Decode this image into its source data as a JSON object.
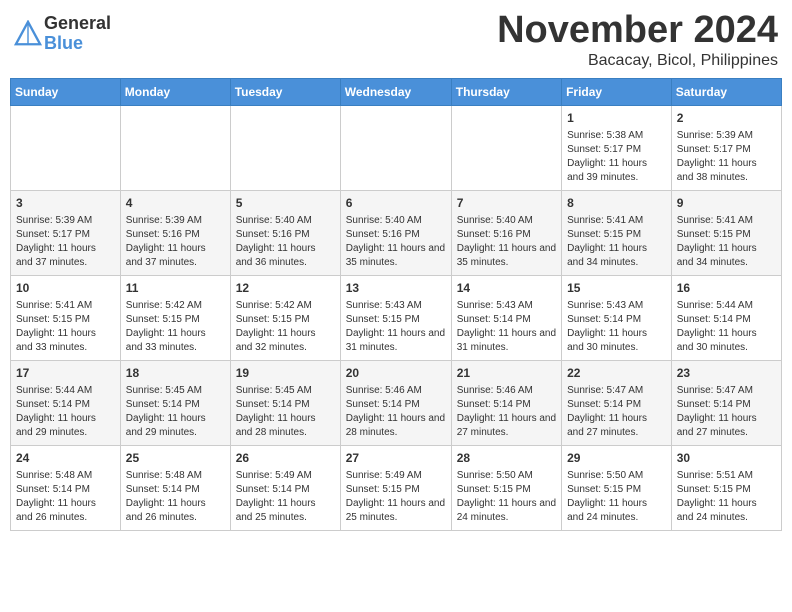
{
  "header": {
    "logo_general": "General",
    "logo_blue": "Blue",
    "month_title": "November 2024",
    "location": "Bacacay, Bicol, Philippines"
  },
  "weekdays": [
    "Sunday",
    "Monday",
    "Tuesday",
    "Wednesday",
    "Thursday",
    "Friday",
    "Saturday"
  ],
  "weeks": [
    [
      {
        "day": "",
        "sunrise": "",
        "sunset": "",
        "daylight": ""
      },
      {
        "day": "",
        "sunrise": "",
        "sunset": "",
        "daylight": ""
      },
      {
        "day": "",
        "sunrise": "",
        "sunset": "",
        "daylight": ""
      },
      {
        "day": "",
        "sunrise": "",
        "sunset": "",
        "daylight": ""
      },
      {
        "day": "",
        "sunrise": "",
        "sunset": "",
        "daylight": ""
      },
      {
        "day": "1",
        "sunrise": "Sunrise: 5:38 AM",
        "sunset": "Sunset: 5:17 PM",
        "daylight": "Daylight: 11 hours and 39 minutes."
      },
      {
        "day": "2",
        "sunrise": "Sunrise: 5:39 AM",
        "sunset": "Sunset: 5:17 PM",
        "daylight": "Daylight: 11 hours and 38 minutes."
      }
    ],
    [
      {
        "day": "3",
        "sunrise": "Sunrise: 5:39 AM",
        "sunset": "Sunset: 5:17 PM",
        "daylight": "Daylight: 11 hours and 37 minutes."
      },
      {
        "day": "4",
        "sunrise": "Sunrise: 5:39 AM",
        "sunset": "Sunset: 5:16 PM",
        "daylight": "Daylight: 11 hours and 37 minutes."
      },
      {
        "day": "5",
        "sunrise": "Sunrise: 5:40 AM",
        "sunset": "Sunset: 5:16 PM",
        "daylight": "Daylight: 11 hours and 36 minutes."
      },
      {
        "day": "6",
        "sunrise": "Sunrise: 5:40 AM",
        "sunset": "Sunset: 5:16 PM",
        "daylight": "Daylight: 11 hours and 35 minutes."
      },
      {
        "day": "7",
        "sunrise": "Sunrise: 5:40 AM",
        "sunset": "Sunset: 5:16 PM",
        "daylight": "Daylight: 11 hours and 35 minutes."
      },
      {
        "day": "8",
        "sunrise": "Sunrise: 5:41 AM",
        "sunset": "Sunset: 5:15 PM",
        "daylight": "Daylight: 11 hours and 34 minutes."
      },
      {
        "day": "9",
        "sunrise": "Sunrise: 5:41 AM",
        "sunset": "Sunset: 5:15 PM",
        "daylight": "Daylight: 11 hours and 34 minutes."
      }
    ],
    [
      {
        "day": "10",
        "sunrise": "Sunrise: 5:41 AM",
        "sunset": "Sunset: 5:15 PM",
        "daylight": "Daylight: 11 hours and 33 minutes."
      },
      {
        "day": "11",
        "sunrise": "Sunrise: 5:42 AM",
        "sunset": "Sunset: 5:15 PM",
        "daylight": "Daylight: 11 hours and 33 minutes."
      },
      {
        "day": "12",
        "sunrise": "Sunrise: 5:42 AM",
        "sunset": "Sunset: 5:15 PM",
        "daylight": "Daylight: 11 hours and 32 minutes."
      },
      {
        "day": "13",
        "sunrise": "Sunrise: 5:43 AM",
        "sunset": "Sunset: 5:15 PM",
        "daylight": "Daylight: 11 hours and 31 minutes."
      },
      {
        "day": "14",
        "sunrise": "Sunrise: 5:43 AM",
        "sunset": "Sunset: 5:14 PM",
        "daylight": "Daylight: 11 hours and 31 minutes."
      },
      {
        "day": "15",
        "sunrise": "Sunrise: 5:43 AM",
        "sunset": "Sunset: 5:14 PM",
        "daylight": "Daylight: 11 hours and 30 minutes."
      },
      {
        "day": "16",
        "sunrise": "Sunrise: 5:44 AM",
        "sunset": "Sunset: 5:14 PM",
        "daylight": "Daylight: 11 hours and 30 minutes."
      }
    ],
    [
      {
        "day": "17",
        "sunrise": "Sunrise: 5:44 AM",
        "sunset": "Sunset: 5:14 PM",
        "daylight": "Daylight: 11 hours and 29 minutes."
      },
      {
        "day": "18",
        "sunrise": "Sunrise: 5:45 AM",
        "sunset": "Sunset: 5:14 PM",
        "daylight": "Daylight: 11 hours and 29 minutes."
      },
      {
        "day": "19",
        "sunrise": "Sunrise: 5:45 AM",
        "sunset": "Sunset: 5:14 PM",
        "daylight": "Daylight: 11 hours and 28 minutes."
      },
      {
        "day": "20",
        "sunrise": "Sunrise: 5:46 AM",
        "sunset": "Sunset: 5:14 PM",
        "daylight": "Daylight: 11 hours and 28 minutes."
      },
      {
        "day": "21",
        "sunrise": "Sunrise: 5:46 AM",
        "sunset": "Sunset: 5:14 PM",
        "daylight": "Daylight: 11 hours and 27 minutes."
      },
      {
        "day": "22",
        "sunrise": "Sunrise: 5:47 AM",
        "sunset": "Sunset: 5:14 PM",
        "daylight": "Daylight: 11 hours and 27 minutes."
      },
      {
        "day": "23",
        "sunrise": "Sunrise: 5:47 AM",
        "sunset": "Sunset: 5:14 PM",
        "daylight": "Daylight: 11 hours and 27 minutes."
      }
    ],
    [
      {
        "day": "24",
        "sunrise": "Sunrise: 5:48 AM",
        "sunset": "Sunset: 5:14 PM",
        "daylight": "Daylight: 11 hours and 26 minutes."
      },
      {
        "day": "25",
        "sunrise": "Sunrise: 5:48 AM",
        "sunset": "Sunset: 5:14 PM",
        "daylight": "Daylight: 11 hours and 26 minutes."
      },
      {
        "day": "26",
        "sunrise": "Sunrise: 5:49 AM",
        "sunset": "Sunset: 5:14 PM",
        "daylight": "Daylight: 11 hours and 25 minutes."
      },
      {
        "day": "27",
        "sunrise": "Sunrise: 5:49 AM",
        "sunset": "Sunset: 5:15 PM",
        "daylight": "Daylight: 11 hours and 25 minutes."
      },
      {
        "day": "28",
        "sunrise": "Sunrise: 5:50 AM",
        "sunset": "Sunset: 5:15 PM",
        "daylight": "Daylight: 11 hours and 24 minutes."
      },
      {
        "day": "29",
        "sunrise": "Sunrise: 5:50 AM",
        "sunset": "Sunset: 5:15 PM",
        "daylight": "Daylight: 11 hours and 24 minutes."
      },
      {
        "day": "30",
        "sunrise": "Sunrise: 5:51 AM",
        "sunset": "Sunset: 5:15 PM",
        "daylight": "Daylight: 11 hours and 24 minutes."
      }
    ]
  ]
}
